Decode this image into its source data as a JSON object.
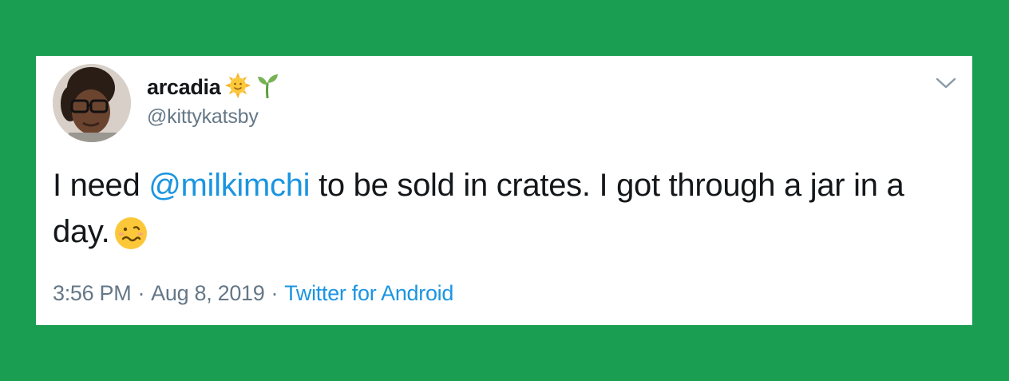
{
  "tweet": {
    "display_name": "arcadia",
    "name_emojis": [
      "sun-with-face-icon",
      "seedling-icon"
    ],
    "handle": "@kittykatsby",
    "text_before": "I need ",
    "mention": "@milkimchi",
    "text_after": " to be sold in crates. I got through a jar in a day.",
    "text_emoji": "woozy-face-icon",
    "time": "3:56 PM",
    "separator": "·",
    "date": "Aug 8, 2019",
    "source": "Twitter for Android"
  },
  "colors": {
    "background": "#1a9e52",
    "card": "#ffffff",
    "text": "#14171a",
    "secondary": "#657786",
    "link": "#1b95e0"
  }
}
